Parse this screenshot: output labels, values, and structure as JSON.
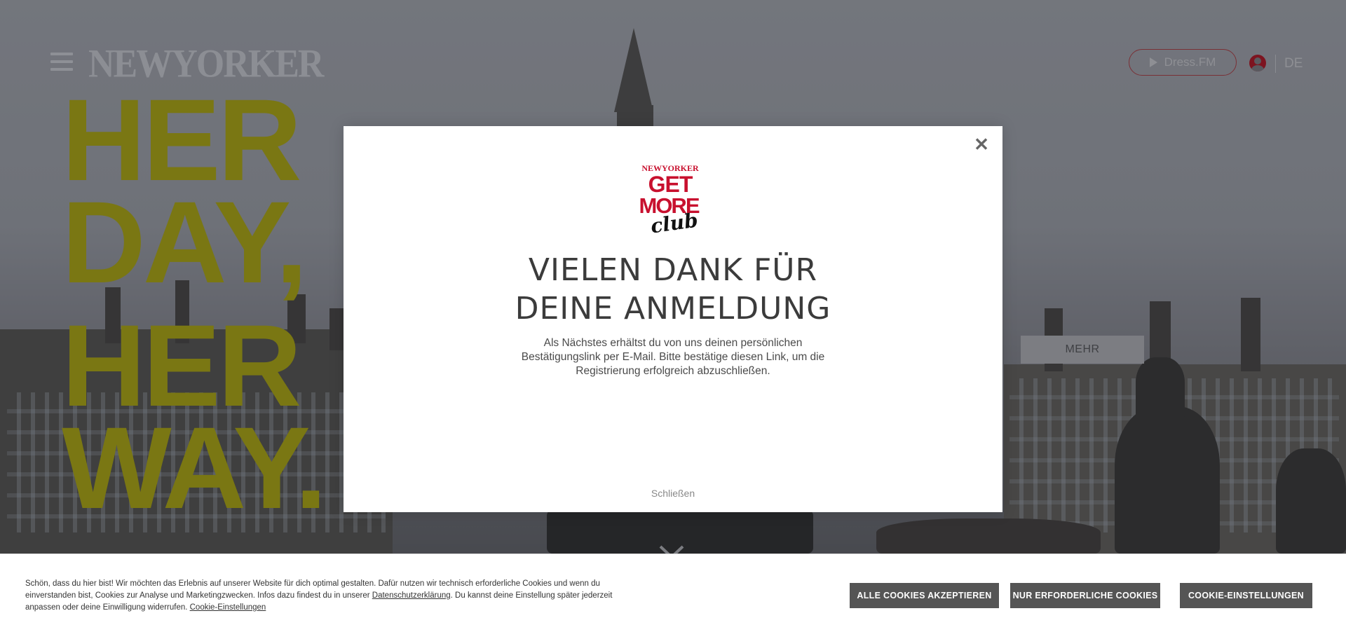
{
  "header": {
    "brand": "NEWYORKER",
    "radio_label": "Dress.FM",
    "language": "DE"
  },
  "hero": {
    "headline_lines": [
      "HER",
      "DAY,",
      "HER",
      "WAY."
    ],
    "more_button": "MEHR"
  },
  "modal": {
    "logo": {
      "brand": "NEWYORKER",
      "line1": "GET",
      "line2": "MORE",
      "script": "club"
    },
    "title_line1": "VIELEN DANK FÜR",
    "title_line2": "DEINE ANMELDUNG",
    "body": "Als Nächstes erhältst du von uns deinen persönlichen Bestätigungslink per E-Mail. Bitte bestätige diesen Link, um die Registrierung erfolgreich abzuschließen.",
    "close_link": "Schließen"
  },
  "cookie_banner": {
    "text_part1": "Schön, dass du hier bist! Wir möchten das Erlebnis auf unserer Website für dich optimal gestalten. Dafür nutzen wir technisch erforderliche Cookies und wenn du einverstanden bist, Cookies zur Analyse und Marketingzwecken. Infos dazu findest du in unserer ",
    "privacy_link": "Datenschutzerklärung",
    "text_part2": ". Du kannst deine Einstellung später jederzeit anpassen oder deine Einwilligung widerrufen. ",
    "settings_link": "Cookie-Einstellungen",
    "accept_all": "ALLE COOKIES AKZEPTIEREN",
    "required_only": "NUR ERFORDERLICHE COOKIES",
    "settings_button": "COOKIE-EINSTELLUNGEN"
  },
  "colors": {
    "headline": "#7a7713",
    "brand_red": "#c8102e",
    "cookie_button": "#555555"
  }
}
